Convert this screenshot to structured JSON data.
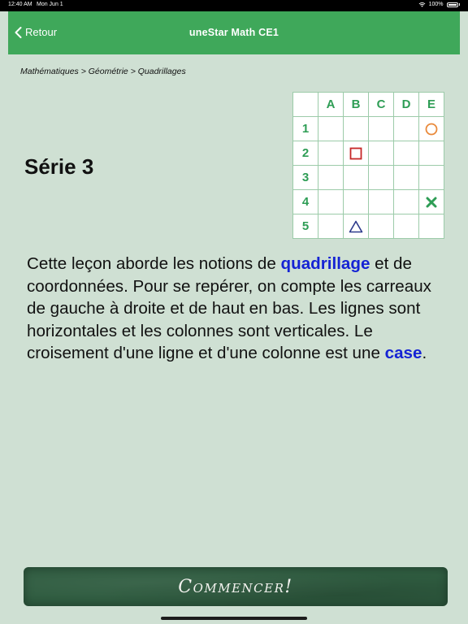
{
  "statusbar": {
    "time": "12:40 AM",
    "date": "Mon Jun 1",
    "battery": "100%",
    "wifi_icon": "wifi-icon",
    "battery_icon": "battery-icon"
  },
  "navbar": {
    "back_label": "Retour",
    "title": "uneStar Math CE1",
    "back_icon": "chevron-left-icon",
    "color": "#3fa85a"
  },
  "breadcrumb": "Mathématiques > Géométrie > Quadrillages",
  "series_title": "Série 3",
  "grid": {
    "columns": [
      "A",
      "B",
      "C",
      "D",
      "E"
    ],
    "rows": [
      "1",
      "2",
      "3",
      "4",
      "5"
    ],
    "shapes": [
      {
        "row": "1",
        "col": "E",
        "shape": "circle",
        "color": "#e9893a"
      },
      {
        "row": "2",
        "col": "B",
        "shape": "square",
        "color": "#c62828"
      },
      {
        "row": "4",
        "col": "E",
        "shape": "cross",
        "color": "#2e9d55"
      },
      {
        "row": "5",
        "col": "B",
        "shape": "triangle",
        "color": "#2d3a8c"
      }
    ]
  },
  "lesson": {
    "p1": "Cette leçon aborde les notions de ",
    "kw1": "quadrillage",
    "p2": " et de coordonnées. Pour se repérer, on compte les carreaux de gauche à droite et de haut en bas. Les lignes sont horizontales et les colonnes sont verticales. Le croisement d'une ligne et d'une colonne est une ",
    "kw2": "case",
    "p3": ".",
    "keyword_color": "#1523d4"
  },
  "start_button": {
    "label": "Commencer!"
  }
}
